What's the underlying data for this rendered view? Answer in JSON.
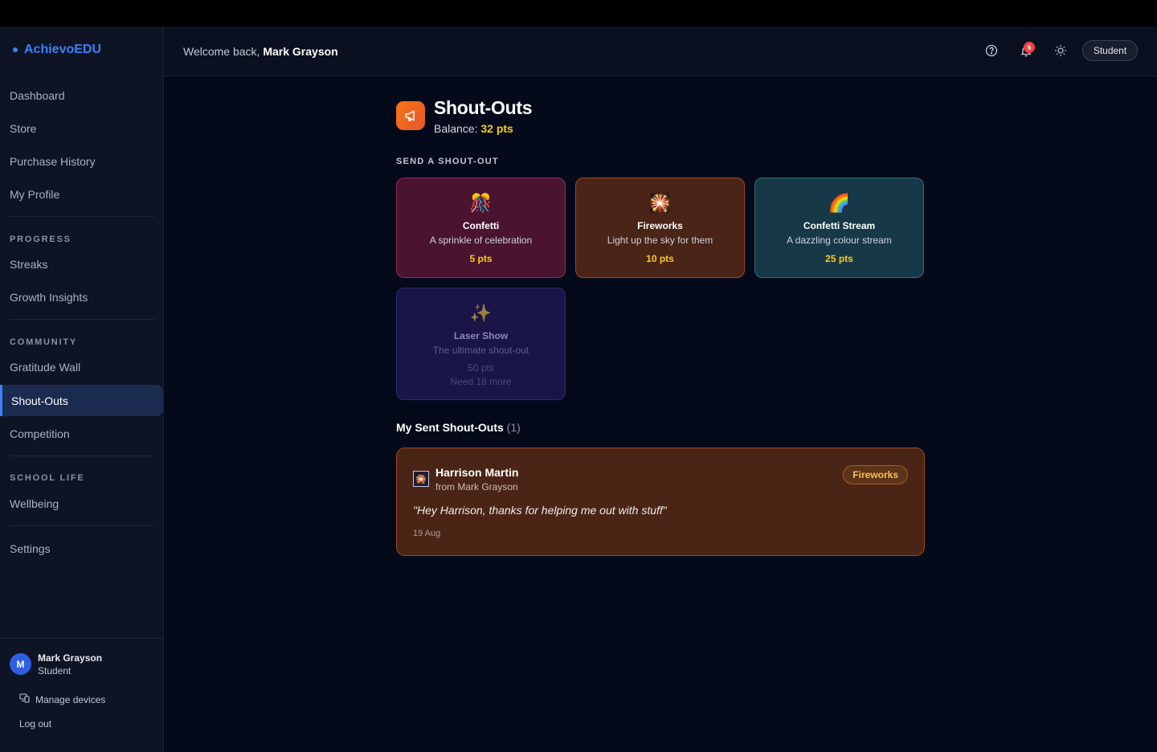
{
  "brand": {
    "name": "AchievoEDU"
  },
  "sidebar": {
    "items": [
      {
        "label": "Dashboard"
      },
      {
        "label": "Store"
      },
      {
        "label": "Purchase History"
      },
      {
        "label": "My Profile"
      }
    ],
    "progress": {
      "heading": "PROGRESS",
      "items": [
        {
          "label": "Streaks"
        },
        {
          "label": "Growth Insights"
        }
      ]
    },
    "community": {
      "heading": "COMMUNITY",
      "items": [
        {
          "label": "Gratitude Wall"
        },
        {
          "label": "Shout-Outs"
        },
        {
          "label": "Competition"
        }
      ]
    },
    "school_life": {
      "heading": "SCHOOL LIFE",
      "items": [
        {
          "label": "Wellbeing"
        }
      ]
    },
    "settings": {
      "label": "Settings"
    },
    "user": {
      "initial": "M",
      "name": "Mark Grayson",
      "role": "Student"
    },
    "manage_devices": "Manage devices",
    "logout": "Log out"
  },
  "header": {
    "welcome_prefix": "Welcome back,",
    "welcome_name": "Mark Grayson",
    "notification_count": "6",
    "role_button": "Student",
    "icons": [
      "help-icon",
      "bell-icon",
      "sun-icon"
    ]
  },
  "page": {
    "title": "Shout-Outs",
    "balance_label": "Balance:",
    "balance_value": "32 pts",
    "send_heading": "SEND A SHOUT-OUT",
    "shoutouts": [
      {
        "emoji": "🎊",
        "name": "Confetti",
        "desc": "A sprinkle of celebration",
        "pts": "5 pts"
      },
      {
        "emoji": "🎇",
        "name": "Fireworks",
        "desc": "Light up the sky for them",
        "pts": "10 pts"
      },
      {
        "emoji": "🌈",
        "name": "Confetti Stream",
        "desc": "A dazzling colour stream",
        "pts": "25 pts"
      },
      {
        "emoji": "✨",
        "name": "Laser Show",
        "desc": "The ultimate shout-out",
        "pts": "50 pts",
        "need": "Need 18 more"
      }
    ],
    "sent_title": "My Sent Shout-Outs",
    "sent_count": "(1)",
    "sent": [
      {
        "emoji": "🎇",
        "to": "Harrison Martin",
        "from": "from Mark Grayson",
        "type": "Fireworks",
        "message": "\"Hey Harrison, thanks for helping me out with stuff\"",
        "date": "19 Aug"
      }
    ]
  },
  "colors": {
    "accent": "#3b82f6",
    "points": "#facc15",
    "badge": "#ef4444"
  }
}
